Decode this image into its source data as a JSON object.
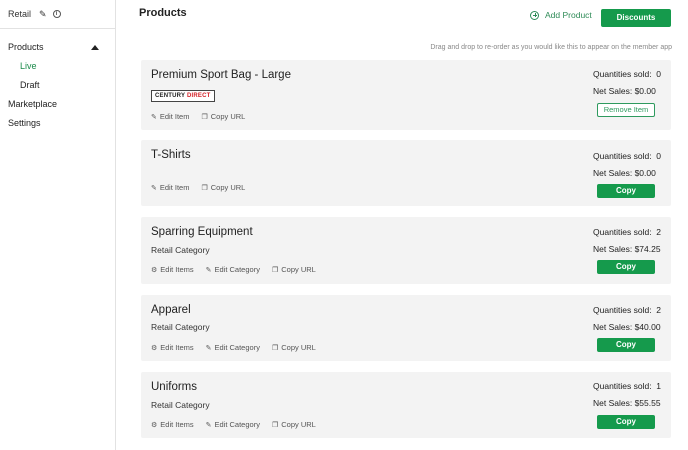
{
  "sidebar": {
    "title": "Retail",
    "items": [
      {
        "label": "Products"
      },
      {
        "label": "Live"
      },
      {
        "label": "Draft"
      },
      {
        "label": "Marketplace"
      },
      {
        "label": "Settings"
      }
    ]
  },
  "header": {
    "title": "Products",
    "add_product": "Add Product",
    "discounts": "Discounts",
    "hint": "Drag and drop to re-order as you would like this to appear on the member app"
  },
  "products": [
    {
      "name": "Premium Sport Bag - Large",
      "logo": {
        "part1": "CENTURY",
        "part2": "DIRECT"
      },
      "actions": [
        "Edit Item",
        "Copy URL"
      ],
      "qty_label": "Quantities sold:",
      "qty": "0",
      "sales": "Net Sales: $0.00",
      "button": "Remove Item"
    },
    {
      "name": "T-Shirts",
      "actions": [
        "Edit Item",
        "Copy URL"
      ],
      "qty_label": "Quantities sold:",
      "qty": "0",
      "sales": "Net Sales: $0.00",
      "button": "Copy"
    },
    {
      "name": "Sparring Equipment",
      "subtitle": "Retail Category",
      "actions": [
        "Edit Items",
        "Edit Category",
        "Copy URL"
      ],
      "qty_label": "Quantities sold:",
      "qty": "2",
      "sales": "Net Sales: $74.25",
      "button": "Copy"
    },
    {
      "name": "Apparel",
      "subtitle": "Retail Category",
      "actions": [
        "Edit Items",
        "Edit Category",
        "Copy URL"
      ],
      "qty_label": "Quantities sold:",
      "qty": "2",
      "sales": "Net Sales: $40.00",
      "button": "Copy"
    },
    {
      "name": "Uniforms",
      "subtitle": "Retail Category",
      "actions": [
        "Edit Items",
        "Edit Category",
        "Copy URL"
      ],
      "qty_label": "Quantities sold:",
      "qty": "1",
      "sales": "Net Sales: $55.55",
      "button": "Copy"
    }
  ],
  "colors": {
    "accent": "#159a4c",
    "card_bg": "#f3f3f3"
  }
}
